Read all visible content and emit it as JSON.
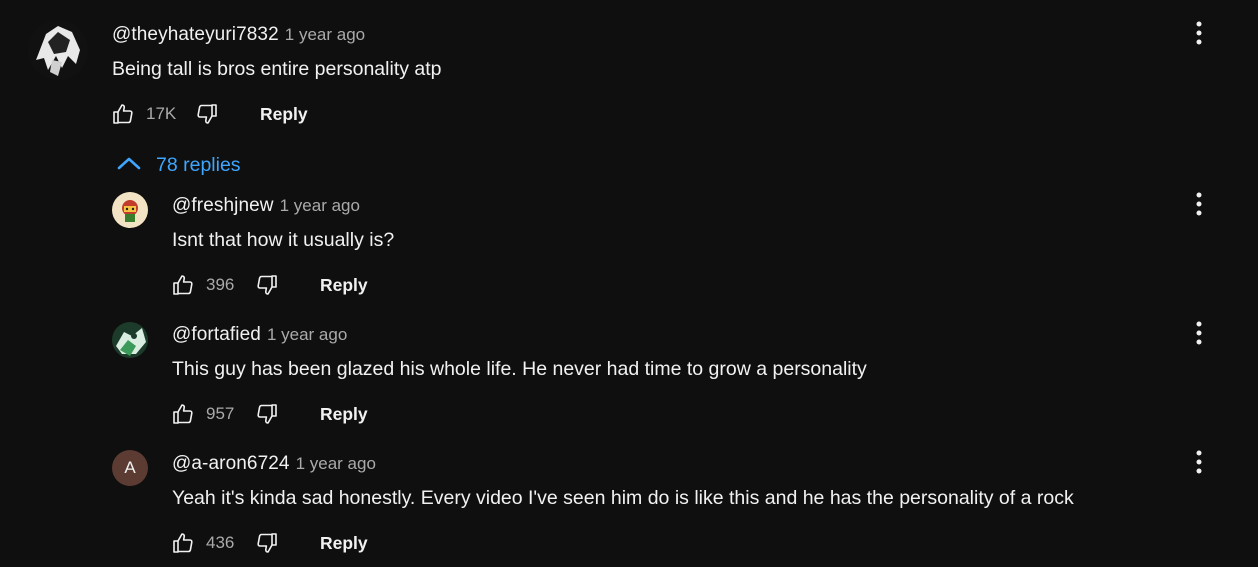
{
  "colors": {
    "background": "#0f0f0f",
    "text_primary": "#f1f1f1",
    "text_secondary": "#aaaaaa",
    "link_blue": "#3ea6ff",
    "letter_avatar_bg": "#5b3b32"
  },
  "top_comment": {
    "author": "@theyhateyuri7832",
    "time": "1 year ago",
    "text": "Being tall is bros entire personality atp",
    "likes": "17K",
    "reply_label": "Reply",
    "avatar_icon": "anime-avatar-icon"
  },
  "replies_toggle": {
    "label": "78 replies",
    "icon": "chevron-up-icon"
  },
  "replies": [
    {
      "author": "@freshjnew",
      "time": "1 year ago",
      "text": "Isnt that how it usually is?",
      "likes": "396",
      "reply_label": "Reply",
      "avatar_icon": "character-avatar-icon"
    },
    {
      "author": "@fortafied",
      "time": "1 year ago",
      "text": "This guy has been glazed his whole life. He never had time to grow a personality",
      "likes": "957",
      "reply_label": "Reply",
      "avatar_icon": "green-avatar-icon"
    },
    {
      "author": "@a-aron6724",
      "time": "1 year ago",
      "text": "Yeah it's kinda sad honestly. Every video I've seen him do is like this and he has the personality of a rock",
      "likes": "436",
      "reply_label": "Reply",
      "avatar_letter": "A"
    }
  ]
}
